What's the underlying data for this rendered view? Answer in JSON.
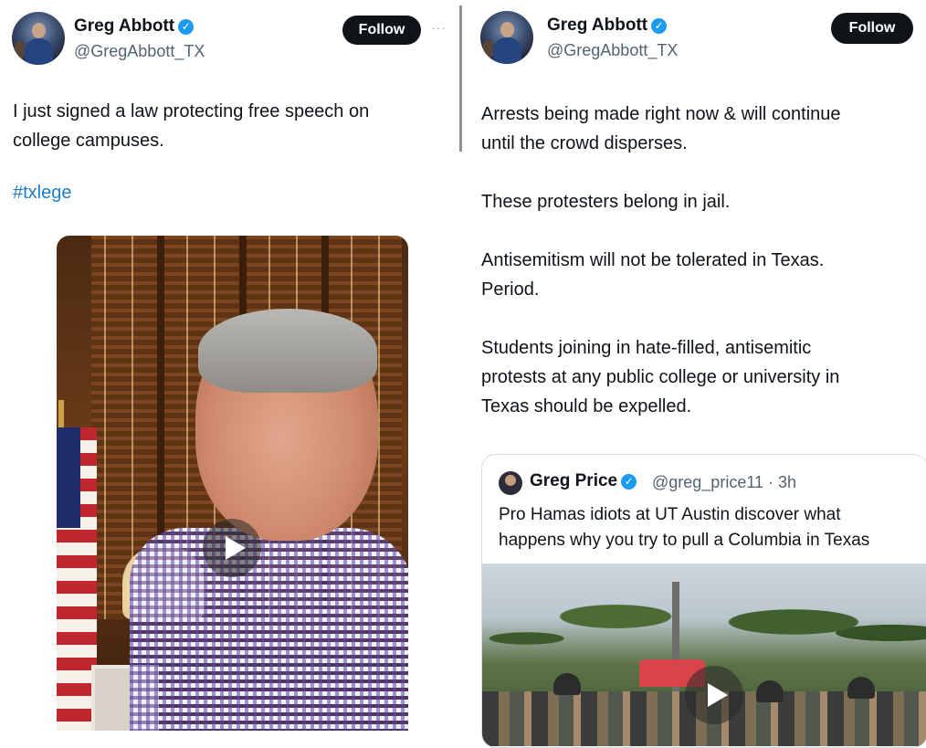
{
  "left_tweet": {
    "author_name": "Greg Abbott",
    "handle": "@GregAbbott_TX",
    "follow_label": "Follow",
    "more_label": "···",
    "text_lines": [
      "I just signed a law protecting free speech on",
      "college campuses."
    ],
    "hashtag": "#txlege"
  },
  "right_tweet": {
    "author_name": "Greg Abbott",
    "handle": "@GregAbbott_TX",
    "follow_label": "Follow",
    "paragraphs": [
      [
        "Arrests being made right now & will continue",
        "until the crowd disperses."
      ],
      [
        "These protesters belong in jail."
      ],
      [
        "Antisemitism will not be tolerated in Texas.",
        "Period."
      ],
      [
        "Students joining in hate-filled, antisemitic",
        "protests at any public college or university in",
        "Texas should be expelled."
      ]
    ],
    "quote": {
      "author_name": "Greg Price",
      "handle_time": "@greg_price11 · 3h",
      "text_lines": [
        "Pro Hamas idiots at UT Austin discover what",
        "happens why you try to pull a Columbia in Texas"
      ]
    }
  },
  "icons": {
    "verified": "✓"
  },
  "colors": {
    "follow_bg": "#0f1419",
    "hashtag": "#1d7dc8",
    "verified": "#1d9bf0",
    "handle": "#536471"
  }
}
